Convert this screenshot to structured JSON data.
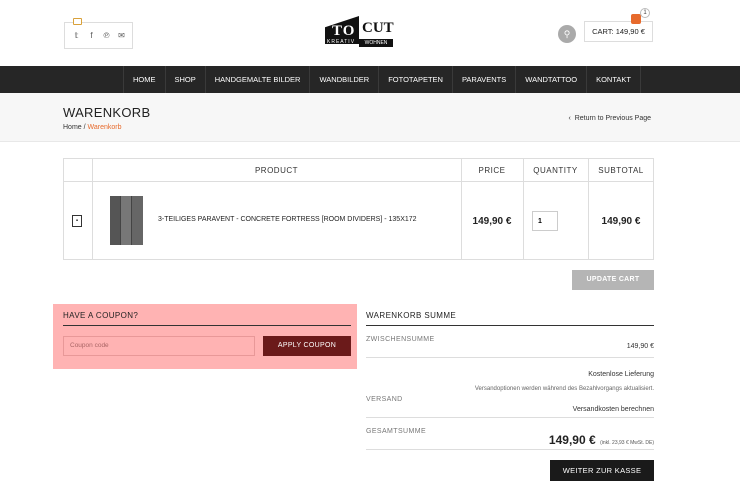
{
  "header": {
    "social_icons": [
      "twitter-icon",
      "facebook-icon",
      "pinterest-icon",
      "email-icon"
    ],
    "logo": {
      "to": "TO",
      "cut": "CUT",
      "kreativ": "KREATIV",
      "wohnen": "WOHNEN"
    },
    "cart_label": "CART: 149,90 €",
    "cart_count": "1"
  },
  "nav": {
    "items": [
      "HOME",
      "SHOP",
      "HANDGEMALTE BILDER",
      "WANDBILDER",
      "FOTOTAPETEN",
      "PARAVENTS",
      "WANDTATTOO",
      "KONTAKT"
    ]
  },
  "titlebar": {
    "title": "WARENKORB",
    "breadcrumb_home": "Home",
    "breadcrumb_sep": " / ",
    "breadcrumb_current": "Warenkorb",
    "return_link": "Return to Previous Page"
  },
  "cart": {
    "headers": {
      "product": "PRODUCT",
      "price": "PRICE",
      "quantity": "QUANTITY",
      "subtotal": "SUBTOTAL"
    },
    "item": {
      "name": "3-TEILIGES PARAVENT - CONCRETE FORTRESS [ROOM DIVIDERS] - 135X172",
      "price": "149,90 €",
      "quantity": "1",
      "subtotal": "149,90 €"
    },
    "update_label": "UPDATE CART"
  },
  "coupon": {
    "title": "HAVE A COUPON?",
    "placeholder": "Coupon code",
    "apply_label": "APPLY COUPON"
  },
  "totals": {
    "title": "WARENKORB SUMME",
    "zwischensumme_label": "ZWISCHENSUMME",
    "zwischensumme_value": "149,90 €",
    "shipping_option": "Kostenlose Lieferung",
    "shipping_note": "Versandoptionen werden während des Bezahlvorgangs aktualisiert.",
    "versand_label": "VERSAND",
    "versand_link": "Versandkosten berechnen",
    "gesamt_label": "GESAMTSUMME",
    "gesamt_value": "149,90 €",
    "gesamt_tax": "(inkl. 23,93 € MwSt. DE)",
    "checkout_label": "WEITER ZUR KASSE"
  },
  "colors": {
    "accent": "#e76a2c",
    "nav_bg": "#262626",
    "coupon_bg": "#ffb3b3",
    "apply_btn": "#6b1a1a"
  }
}
